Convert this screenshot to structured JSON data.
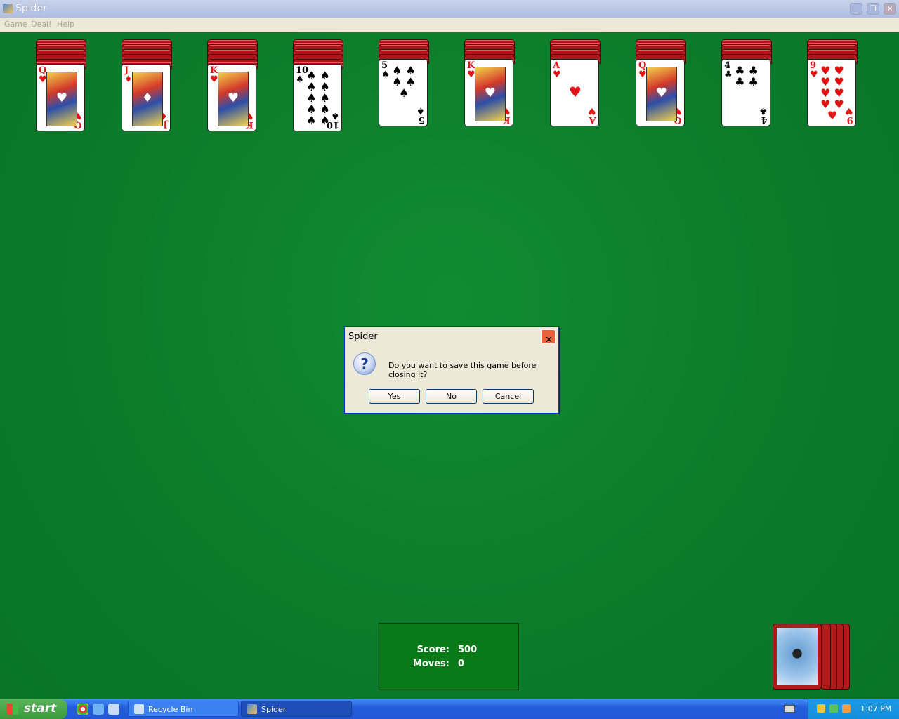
{
  "window": {
    "title": "Spider"
  },
  "menu": [
    "Game",
    "Deal!",
    "Help"
  ],
  "tableau": [
    {
      "rank": "Q",
      "suit": "♥",
      "color": "red",
      "backs": 5,
      "face": "court"
    },
    {
      "rank": "J",
      "suit": "♦",
      "color": "red",
      "backs": 5,
      "face": "court"
    },
    {
      "rank": "K",
      "suit": "♥",
      "color": "red",
      "backs": 5,
      "face": "court"
    },
    {
      "rank": "10",
      "suit": "♠",
      "color": "black",
      "backs": 5,
      "face": "pips"
    },
    {
      "rank": "5",
      "suit": "♠",
      "color": "black",
      "backs": 4,
      "face": "pips"
    },
    {
      "rank": "K",
      "suit": "♥",
      "color": "red",
      "backs": 4,
      "face": "court"
    },
    {
      "rank": "A",
      "suit": "♥",
      "color": "red",
      "backs": 4,
      "face": "pips"
    },
    {
      "rank": "Q",
      "suit": "♥",
      "color": "red",
      "backs": 4,
      "face": "court"
    },
    {
      "rank": "4",
      "suit": "♣",
      "color": "black",
      "backs": 4,
      "face": "pips"
    },
    {
      "rank": "9",
      "suit": "♥",
      "color": "red",
      "backs": 4,
      "face": "pips"
    }
  ],
  "dialog": {
    "title": "Spider",
    "message": "Do you want to save this game before closing it?",
    "yes": "Yes",
    "no": "No",
    "cancel": "Cancel"
  },
  "score": {
    "score_label": "Score:",
    "score_value": "500",
    "moves_label": "Moves:",
    "moves_value": "0"
  },
  "stock": {
    "remaining_deals": 5
  },
  "taskbar": {
    "start": "start",
    "buttons": [
      "Recycle Bin",
      "Spider"
    ],
    "clock": "1:07 PM"
  },
  "colors": {
    "felt": "#0b7a2a",
    "card_back": "#b2121a",
    "red_suit": "#e01515",
    "taskbar": "#245edb"
  }
}
